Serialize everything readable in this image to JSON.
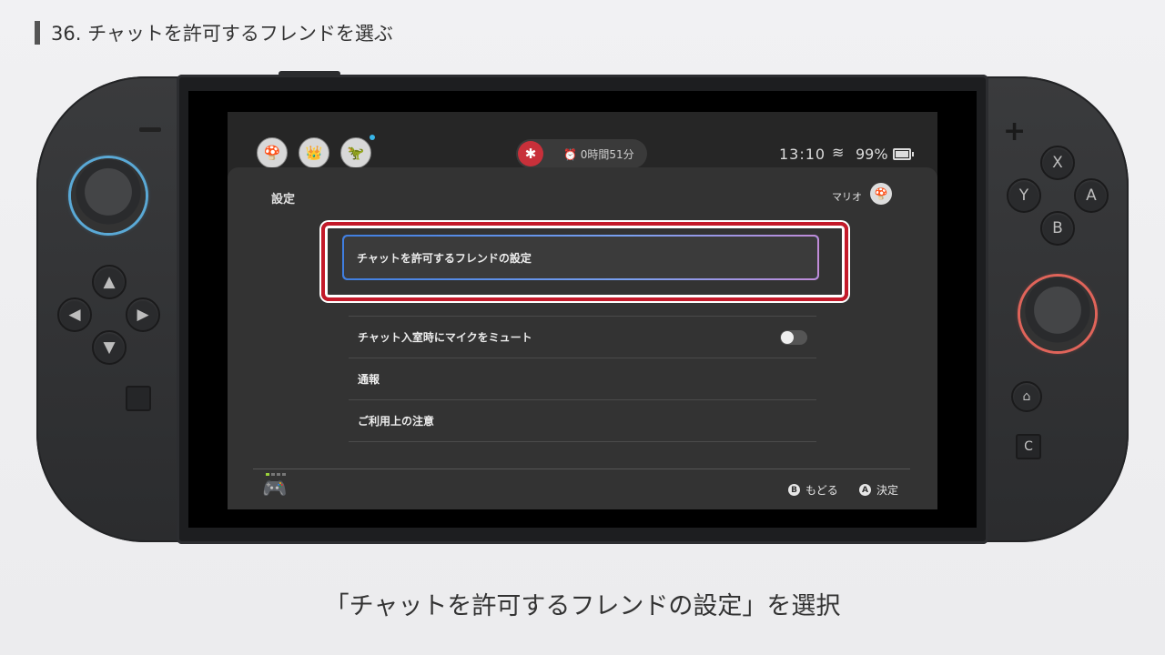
{
  "step": {
    "title": "36. チャットを許可するフレンドを選ぶ"
  },
  "device": {
    "buttons": {
      "x": "X",
      "y": "Y",
      "a": "A",
      "b": "B",
      "capture": "C"
    },
    "dpad": {
      "up": "▲",
      "left": "◀",
      "right": "▶",
      "down": "▼"
    },
    "left_stick_color": "#5aa9d6",
    "right_stick_color": "#e0645a"
  },
  "status_bar": {
    "play_timer": "0時間51分",
    "clock": "13:10",
    "battery": "99%",
    "avatars": [
      "mario",
      "peach",
      "yoshi"
    ]
  },
  "settings": {
    "title": "設定",
    "user_name": "マリオ",
    "selected_item": "チャットを許可するフレンドの設定",
    "items": [
      {
        "label": "チャット入室時にマイクをミュート",
        "toggle": "off"
      },
      {
        "label": "通報"
      },
      {
        "label": "ご利用上の注意"
      }
    ]
  },
  "footer": {
    "back_glyph": "B",
    "back_label": "もどる",
    "confirm_glyph": "A",
    "confirm_label": "決定"
  },
  "caption": "「チャットを許可するフレンドの設定」を選択",
  "colors": {
    "highlight": "#c41a2a",
    "selection_gradient": [
      "#3f7ee0",
      "#c08bd8"
    ]
  }
}
